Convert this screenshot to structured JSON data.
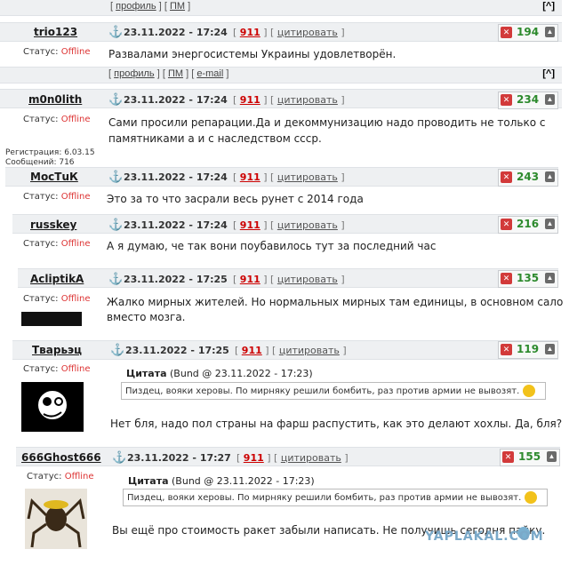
{
  "top_links": {
    "profile": "профиль",
    "pm": "ПМ",
    "up": "[^]"
  },
  "mid_links": {
    "profile": "профиль",
    "pm": "ПМ",
    "email": "e-mail",
    "up": "[^]"
  },
  "status_label": "Статус:",
  "offline": "Offline",
  "cite_label": "цитировать",
  "post_num": "911",
  "posts": [
    {
      "nick": "trio123",
      "date": "23.11.2022 - 17:24",
      "score": "194",
      "text": "Развалами энергосистемы Украины удовлетворён."
    },
    {
      "nick": "m0n0lith",
      "date": "23.11.2022 - 17:24",
      "score": "234",
      "text1": "Сами просили репарации.Да и декоммунизацию надо проводить не только с",
      "text2": "памятниками а и с наследством ссср."
    },
    {
      "nick": "МосТuК",
      "date": "23.11.2022 - 17:24",
      "score": "243",
      "text": "Это за то что засрали весь рунет с 2014 года"
    },
    {
      "nick": "russkey",
      "date": "23.11.2022 - 17:24",
      "score": "216",
      "text": "А я думаю, че так вони поубавилось тут за последний час"
    },
    {
      "nick": "AcliptikA",
      "date": "23.11.2022 - 17:25",
      "score": "135",
      "text1": "Жалко мирных жителей. Но нормальных мирных там единицы, в основном сало",
      "text2": "вместо мозга."
    },
    {
      "nick": "Тварьэц",
      "date": "23.11.2022 - 17:25",
      "score": "119",
      "quote_title": "Цитата",
      "quote_src": "(Bund @ 23.11.2022 - 17:23)",
      "quote": "Пиздец, вояки херовы. По мирняку решили бомбить, раз против армии не вывозят.",
      "text": "Нет бля, надо пол страны на фарш распустить, как это делают хохлы. Да, бля?"
    },
    {
      "nick": "666Ghost666",
      "date": "23.11.2022 - 17:27",
      "score": "155",
      "quote_title": "Цитата",
      "quote_src": "(Bund @ 23.11.2022 - 17:23)",
      "quote": "Пиздец, вояки херовы. По мирняку решили бомбить, раз против армии не вывозят.",
      "text": "Вы ещё про стоимость ракет забыли написать. Не получишь сегодня пайку."
    }
  ],
  "registration": "Регистрация: 6.03.15",
  "messages": "Сообщений: 716",
  "watermark": "YAPLAKAL.COM"
}
